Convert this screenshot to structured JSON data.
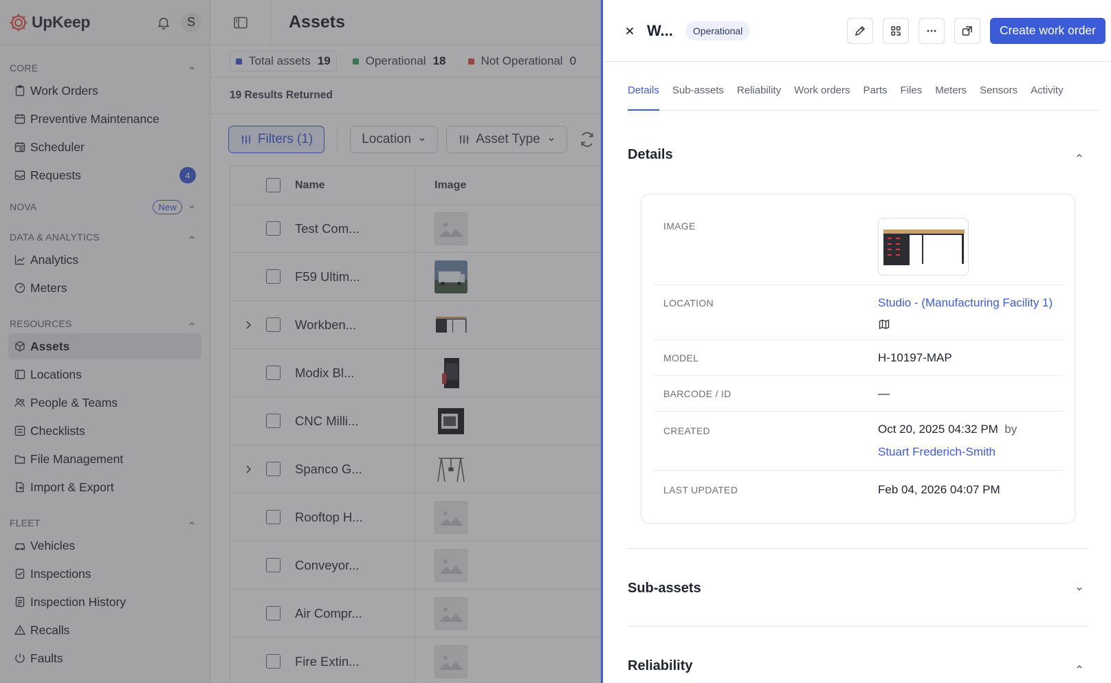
{
  "app": {
    "name": "UpKeep",
    "user_initial": "S"
  },
  "sidebar": {
    "core_label": "CORE",
    "core_items": [
      {
        "label": "Work Orders"
      },
      {
        "label": "Preventive Maintenance"
      },
      {
        "label": "Scheduler"
      },
      {
        "label": "Requests",
        "badge": "4"
      }
    ],
    "nova_label": "NOVA",
    "nova_badge": "New",
    "data_label": "DATA & ANALYTICS",
    "data_items": [
      {
        "label": "Analytics"
      },
      {
        "label": "Meters"
      }
    ],
    "resources_label": "RESOURCES",
    "resources_items": [
      {
        "label": "Assets"
      },
      {
        "label": "Locations"
      },
      {
        "label": "People & Teams"
      },
      {
        "label": "Checklists"
      },
      {
        "label": "File Management"
      },
      {
        "label": "Import & Export"
      }
    ],
    "fleet_label": "FLEET",
    "fleet_items": [
      {
        "label": "Vehicles"
      },
      {
        "label": "Inspections"
      },
      {
        "label": "Inspection History"
      },
      {
        "label": "Recalls"
      },
      {
        "label": "Faults"
      }
    ]
  },
  "main": {
    "title": "Assets",
    "stats": [
      {
        "label": "Total assets",
        "value": "19",
        "color": "#3c5bd6"
      },
      {
        "label": "Operational",
        "value": "18",
        "color": "#3fa45b"
      },
      {
        "label": "Not Operational",
        "value": "0",
        "color": "#e0534a"
      }
    ],
    "results": "19 Results Returned",
    "filters_label": "Filters (1)",
    "location_label": "Location",
    "asset_type_label": "Asset Type",
    "columns": {
      "name": "Name",
      "image": "Image"
    },
    "rows": [
      {
        "name": "Test Com...",
        "expandable": false,
        "thumb": "placeholder"
      },
      {
        "name": "F59 Ultim...",
        "expandable": false,
        "thumb": "truck"
      },
      {
        "name": "Workben...",
        "expandable": true,
        "thumb": "bench"
      },
      {
        "name": "Modix Bl...",
        "expandable": false,
        "thumb": "printer"
      },
      {
        "name": "CNC Milli...",
        "expandable": false,
        "thumb": "cnc"
      },
      {
        "name": "Spanco G...",
        "expandable": true,
        "thumb": "gantry"
      },
      {
        "name": "Rooftop H...",
        "expandable": false,
        "thumb": "placeholder"
      },
      {
        "name": "Conveyor...",
        "expandable": false,
        "thumb": "placeholder"
      },
      {
        "name": "Air Compr...",
        "expandable": false,
        "thumb": "placeholder"
      },
      {
        "name": "Fire Extin...",
        "expandable": false,
        "thumb": "placeholder"
      }
    ]
  },
  "panel": {
    "title": "W...",
    "status": "Operational",
    "create_label": "Create work order",
    "tabs": [
      "Details",
      "Sub-assets",
      "Reliability",
      "Work orders",
      "Parts",
      "Files",
      "Meters",
      "Sensors",
      "Activity"
    ],
    "details_title": "Details",
    "fields": {
      "image_label": "IMAGE",
      "location_label": "LOCATION",
      "location_value": "Studio - (Manufacturing Facility 1)",
      "model_label": "MODEL",
      "model_value": "H-10197-MAP",
      "barcode_label": "BARCODE / ID",
      "barcode_value": "—",
      "created_label": "CREATED",
      "created_value": "Oct 20, 2025 04:32 PM",
      "created_by_word": "by",
      "created_by": "Stuart Frederich-Smith",
      "updated_label": "LAST UPDATED",
      "updated_value": "Feb 04, 2026 04:07 PM"
    },
    "subassets_title": "Sub-assets",
    "reliability_title": "Reliability"
  }
}
